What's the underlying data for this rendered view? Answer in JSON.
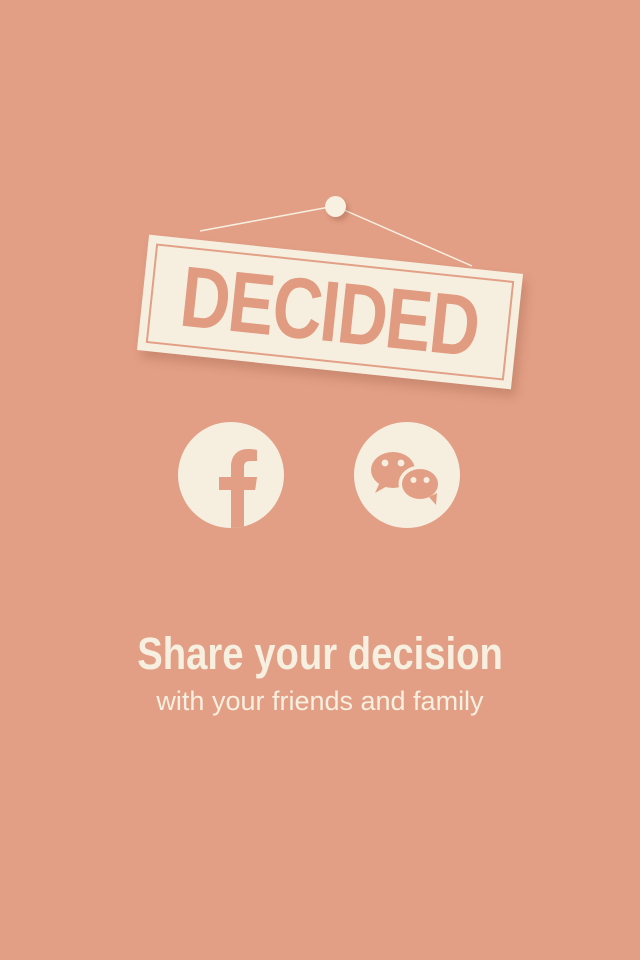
{
  "theme": {
    "background": "#e29f85",
    "cream": "#f6efdf",
    "accent": "#e09b80"
  },
  "sign": {
    "text": "DECIDED"
  },
  "share": {
    "buttons": [
      {
        "icon": "facebook-icon"
      },
      {
        "icon": "wechat-icon"
      }
    ]
  },
  "message": {
    "title": "Share your decision",
    "subtitle": "with your friends and family"
  }
}
